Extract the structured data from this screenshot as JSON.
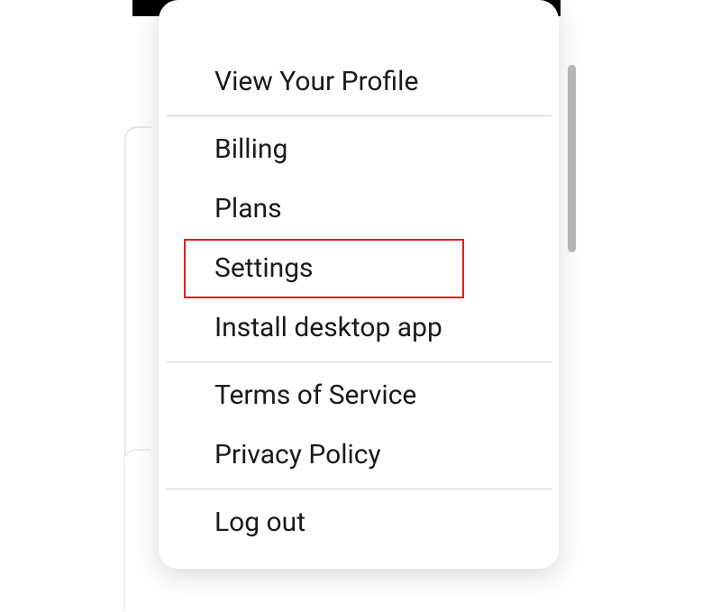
{
  "menu": {
    "profile": {
      "view_label": "View Your Profile"
    },
    "account": {
      "billing_label": "Billing",
      "plans_label": "Plans",
      "settings_label": "Settings",
      "install_label": "Install desktop app"
    },
    "legal": {
      "terms_label": "Terms of Service",
      "privacy_label": "Privacy Policy"
    },
    "logout_label": "Log out"
  },
  "highlighted_item": "settings"
}
